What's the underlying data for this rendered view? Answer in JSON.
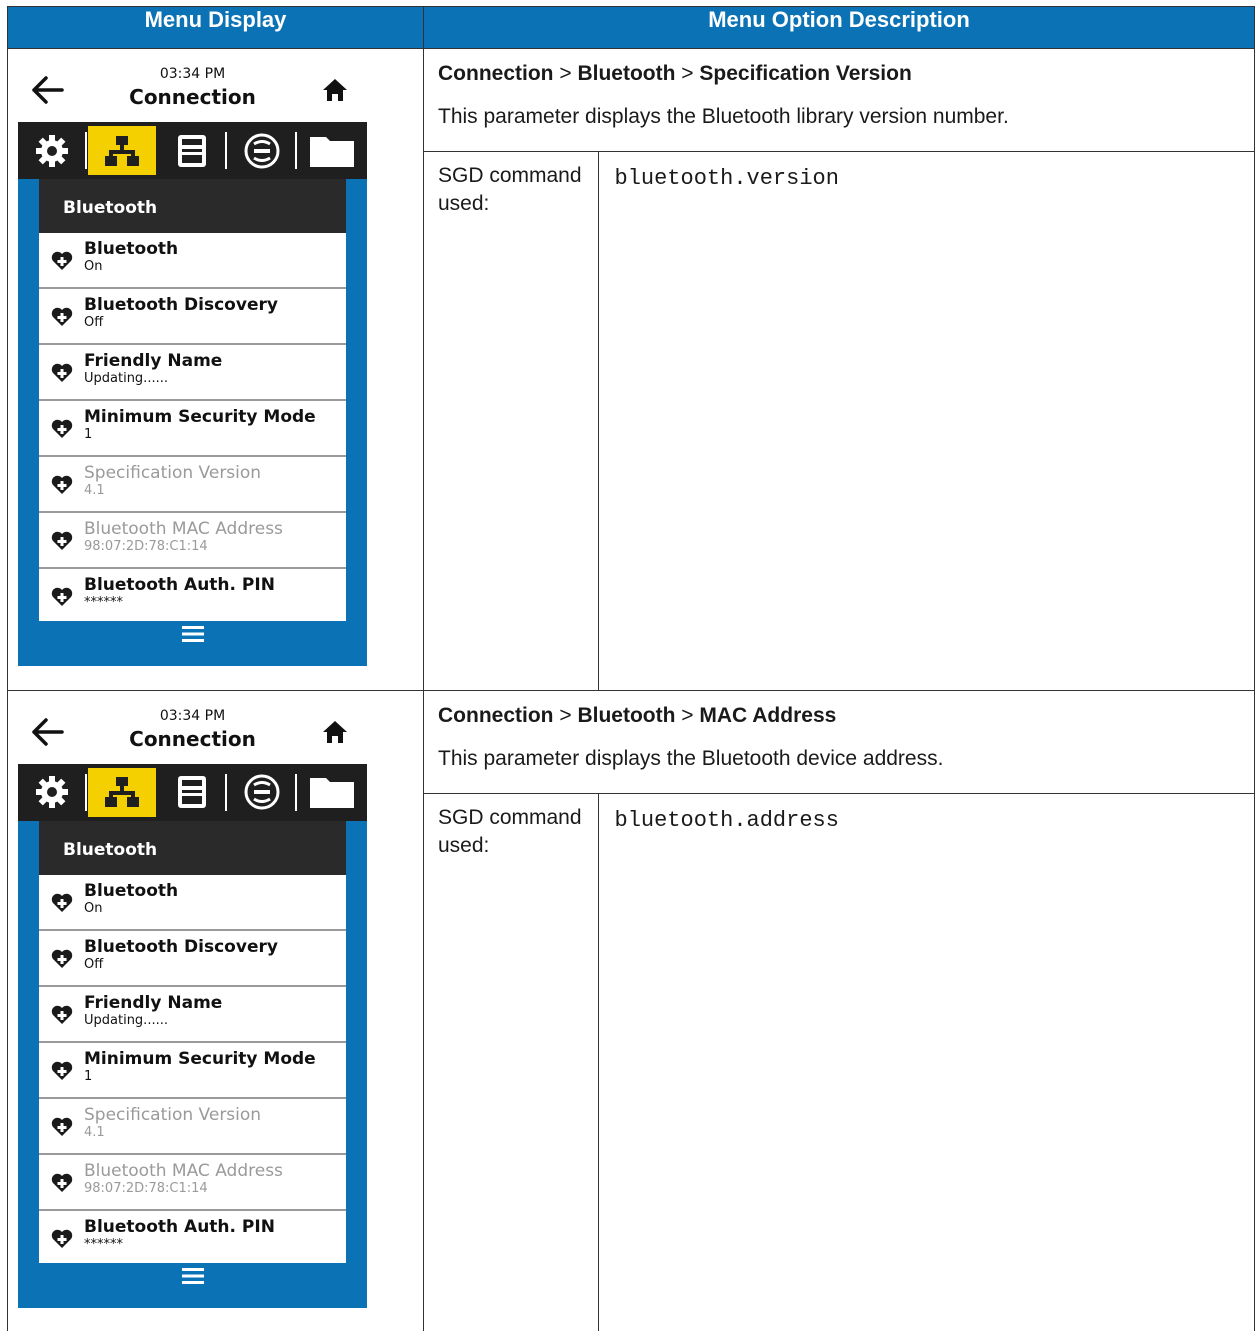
{
  "header": {
    "col1": "Menu Display",
    "col2": "Menu Option Description"
  },
  "screen": {
    "time": "03:34 PM",
    "title": "Connection",
    "list_heading": "Bluetooth",
    "items": [
      {
        "name": "Bluetooth",
        "value": "On",
        "dim": false
      },
      {
        "name": "Bluetooth Discovery",
        "value": "Off",
        "dim": false
      },
      {
        "name": "Friendly Name",
        "value": "Updating......",
        "dim": false
      },
      {
        "name": "Minimum Security Mode",
        "value": "1",
        "dim": false
      },
      {
        "name": "Specification Version",
        "value": "4.1",
        "dim": true
      },
      {
        "name": "Bluetooth MAC Address",
        "value": "98:07:2D:78:C1:14",
        "dim": true
      },
      {
        "name": "Bluetooth Auth. PIN",
        "value": "******",
        "dim": false
      }
    ],
    "icons": [
      "settings-gear-icon",
      "network-icon",
      "printer-icon",
      "sensor-icon",
      "folder-icon"
    ],
    "colors": {
      "background": "#0b72b5",
      "active_tab": "#f5d000",
      "header": "#0b72b5"
    }
  },
  "rows": [
    {
      "path": [
        "Connection",
        "Bluetooth",
        "Specification Version"
      ],
      "path_separator": ">",
      "description": "This parameter displays the Bluetooth library version number.",
      "label": "SGD command used:",
      "command": "bluetooth.version"
    },
    {
      "path": [
        "Connection",
        "Bluetooth",
        "MAC Address"
      ],
      "path_separator": ">",
      "description": "This parameter displays the Bluetooth device address.",
      "label": "SGD command used:",
      "command": "bluetooth.address"
    }
  ]
}
